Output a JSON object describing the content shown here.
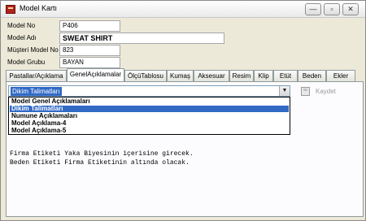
{
  "window": {
    "title": "Model Kartı",
    "minimize_glyph": "—",
    "maximize_glyph": "▫",
    "close_glyph": "✕"
  },
  "form": {
    "model_no_label": "Model No",
    "model_no_value": "P406",
    "model_adi_label": "Model Adı",
    "model_adi_value": "SWEAT SHIRT",
    "musteri_model_no_label": "Müşteri Model No",
    "musteri_model_no_value": "823",
    "model_grubu_label": "Model Grubu",
    "model_grubu_value": "BAYAN"
  },
  "tabs": [
    "Pastallar/Açıklama",
    "GenelAçıklamalar",
    "ÖlçüTablosu",
    "Kumaş",
    "Aksesuar",
    "Resim",
    "Klip",
    "Etüt",
    "Beden",
    "Ekler"
  ],
  "active_tab": "GenelAçıklamalar",
  "combo": {
    "selected": "Dikim Talimatları",
    "arrow_glyph": "▼",
    "options": [
      "Model Genel Açıklamaları",
      "Dikim Talimatları",
      "Numune Açıklamaları",
      "Model Açıklama-4",
      "Model Açıklama-5"
    ]
  },
  "save_button": {
    "label": "Kaydet",
    "icon": "save-icon"
  },
  "memo": {
    "lines": [
      "Firma Etiketi Yaka Biyesinin içerisine girecek.",
      "Beden Etiketi Firma Etiketinin altında olacak."
    ]
  },
  "colors": {
    "selection": "#316ac5",
    "window_bg": "#ece9d8",
    "disabled_text": "#9a9a9a"
  }
}
